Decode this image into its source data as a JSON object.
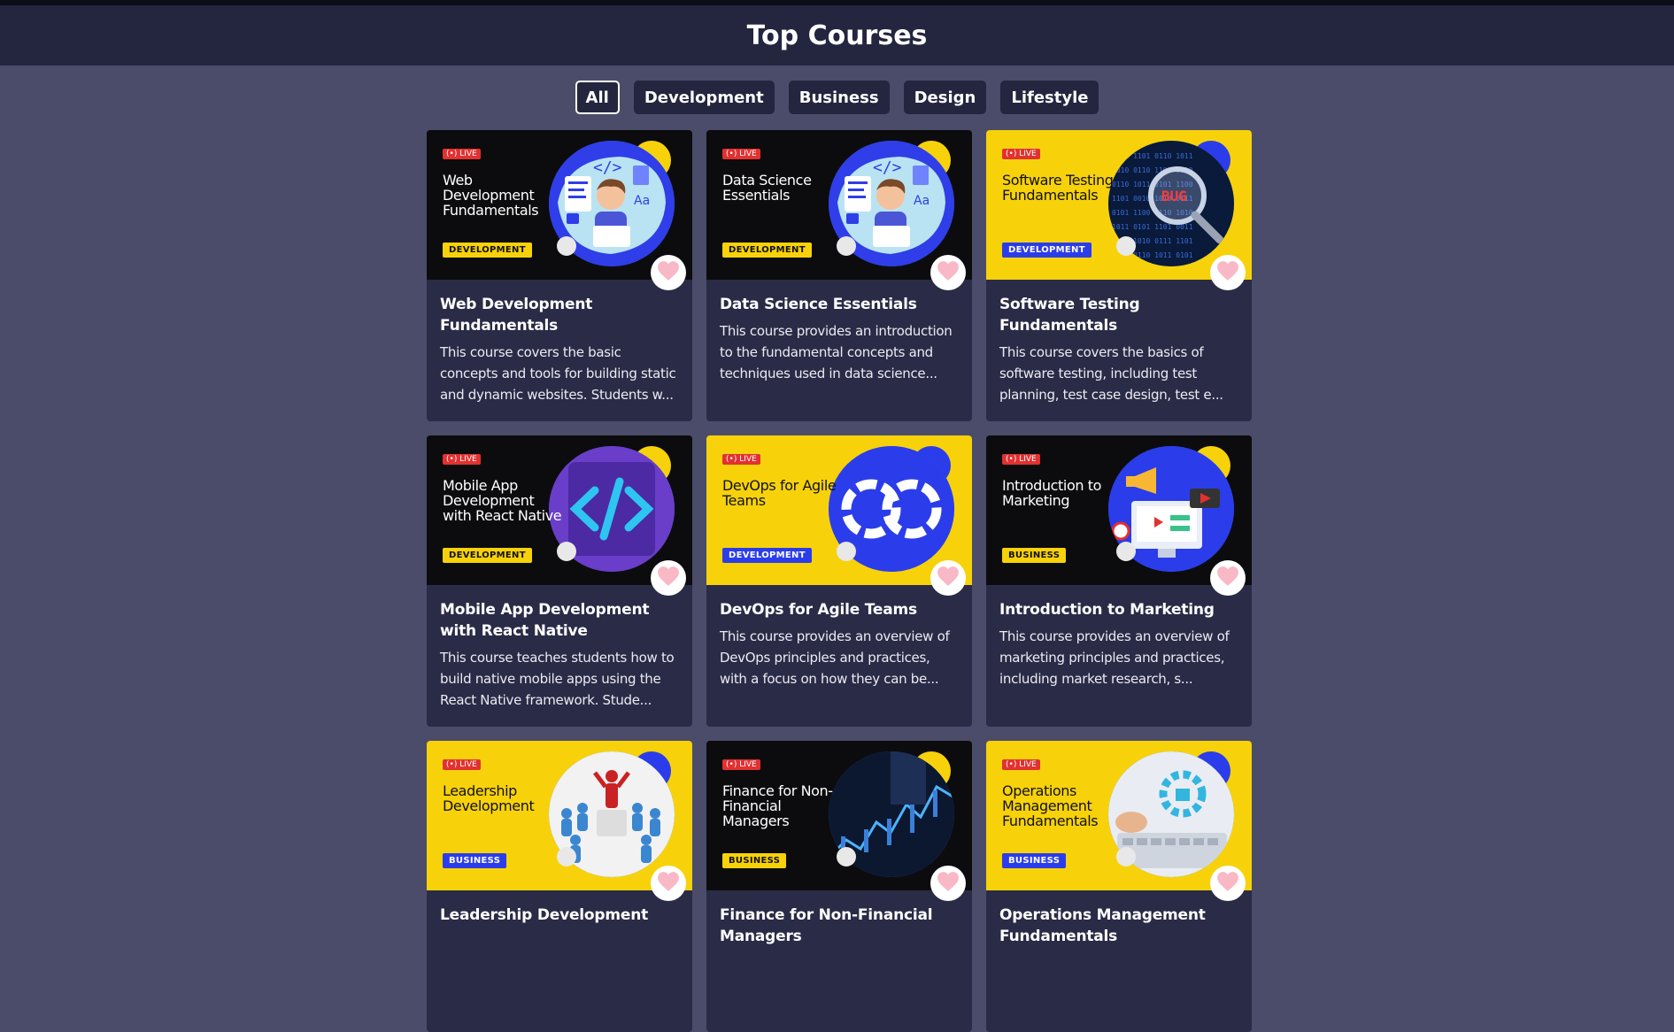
{
  "header": {
    "title": "Top Courses"
  },
  "filters": [
    "All",
    "Development",
    "Business",
    "Design",
    "Lifestyle"
  ],
  "active_filter": "All",
  "live_label": "(•) LIVE",
  "colors": {
    "page_bg": "#4a4c69",
    "header_bg": "#24253f",
    "card_bg": "#2a2b47",
    "yellow": "#f7d20a",
    "blue": "#2b3dea",
    "live_red": "#e23131",
    "heart": "#f9b8c6"
  },
  "courses": [
    {
      "thumb_title": "Web Development Fundamentals",
      "category": "DEVELOPMENT",
      "theme": "dark",
      "art_icon": "developer-illustration-icon",
      "title": "Web Development Fundamentals",
      "description": "This course covers the basic concepts and tools for building static and dynamic websites. Students w..."
    },
    {
      "thumb_title": "Data Science Essentials",
      "category": "DEVELOPMENT",
      "theme": "dark",
      "art_icon": "developer-illustration-icon",
      "title": "Data Science Essentials",
      "description": "This course provides an introduction to the fundamental concepts and techniques used in data science..."
    },
    {
      "thumb_title": "Software Testing Fundamentals",
      "category": "DEVELOPMENT",
      "theme": "yellow",
      "art_icon": "bug-magnifier-icon",
      "title": "Software Testing Fundamentals",
      "description": "This course covers the basics of software testing, including test planning, test case design, test e..."
    },
    {
      "thumb_title": "Mobile App Development with React Native",
      "category": "DEVELOPMENT",
      "theme": "dark",
      "art_icon": "code-brackets-icon",
      "title": "Mobile App Development with React Native",
      "description": "This course teaches students how to build native mobile apps using the React Native framework. Stude..."
    },
    {
      "thumb_title": "DevOps for Agile Teams",
      "category": "DEVELOPMENT",
      "theme": "yellow",
      "art_icon": "infinity-loop-icon",
      "title": "DevOps for Agile Teams",
      "description": "This course provides an overview of DevOps principles and practices, with a focus on how they can be..."
    },
    {
      "thumb_title": "Introduction to Marketing",
      "category": "BUSINESS",
      "theme": "dark",
      "art_icon": "megaphone-marketing-icon",
      "title": "Introduction to Marketing",
      "description": "This course provides an overview of marketing principles and practices, including market research, s..."
    },
    {
      "thumb_title": "Leadership Development",
      "category": "BUSINESS",
      "theme": "yellow",
      "art_icon": "leader-crowd-icon",
      "title": "Leadership Development",
      "description": ""
    },
    {
      "thumb_title": "Finance for Non-Financial Managers",
      "category": "BUSINESS",
      "theme": "dark",
      "art_icon": "finance-chart-icon",
      "title": "Finance for Non-Financial Managers",
      "description": ""
    },
    {
      "thumb_title": "Operations Management Fundamentals",
      "category": "BUSINESS",
      "theme": "yellow",
      "art_icon": "gear-keyboard-icon",
      "title": "Operations Management Fundamentals",
      "description": ""
    }
  ]
}
